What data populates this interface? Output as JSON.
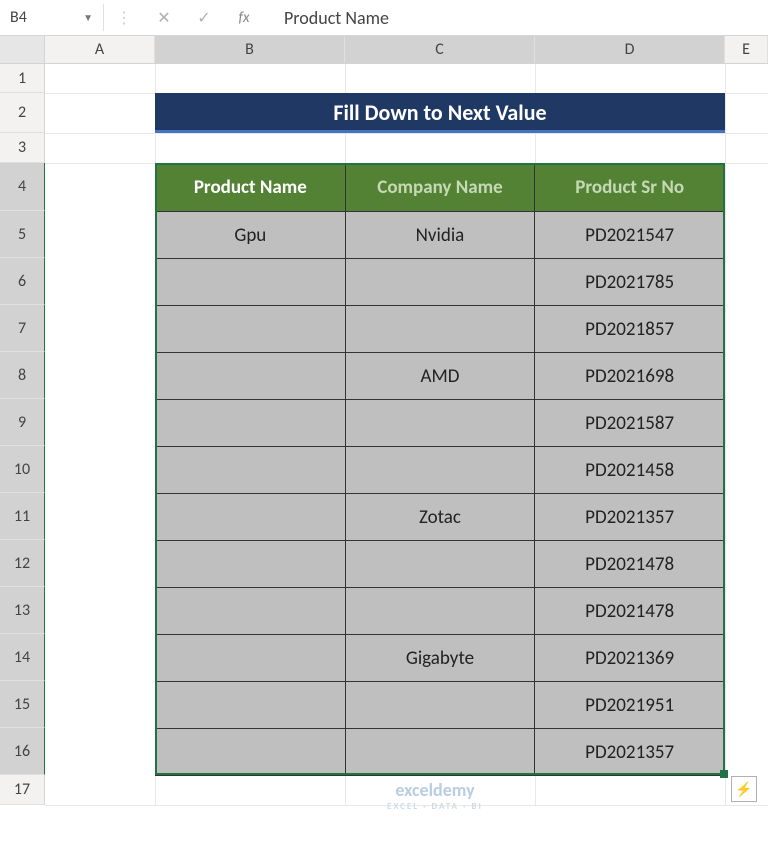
{
  "name_box": {
    "value": "B4"
  },
  "formula_bar": {
    "value": "Product Name"
  },
  "columns": [
    "A",
    "B",
    "C",
    "D",
    "E"
  ],
  "rows": [
    "1",
    "2",
    "3",
    "4",
    "5",
    "6",
    "7",
    "8",
    "9",
    "10",
    "11",
    "12",
    "13",
    "14",
    "15",
    "16",
    "17"
  ],
  "title_banner": "Fill Down to Next Value",
  "table": {
    "headers": [
      "Product Name",
      "Company  Name",
      "Product Sr No"
    ],
    "rows": [
      {
        "product": "Gpu",
        "company": "Nvidia",
        "sr": "PD2021547"
      },
      {
        "product": "",
        "company": "",
        "sr": "PD2021785"
      },
      {
        "product": "",
        "company": "",
        "sr": "PD2021857"
      },
      {
        "product": "",
        "company": "AMD",
        "sr": "PD2021698"
      },
      {
        "product": "",
        "company": "",
        "sr": "PD2021587"
      },
      {
        "product": "",
        "company": "",
        "sr": "PD2021458"
      },
      {
        "product": "",
        "company": "Zotac",
        "sr": "PD2021357"
      },
      {
        "product": "",
        "company": "",
        "sr": "PD2021478"
      },
      {
        "product": "",
        "company": "",
        "sr": "PD2021478"
      },
      {
        "product": "",
        "company": "Gigabyte",
        "sr": "PD2021369"
      },
      {
        "product": "",
        "company": "",
        "sr": "PD2021951"
      },
      {
        "product": "",
        "company": "",
        "sr": "PD2021357"
      }
    ]
  },
  "watermark": {
    "brand": "exceldemy",
    "tag": "EXCEL · DATA · BI"
  },
  "icons": {
    "dropdown": "▼",
    "cancel": "✕",
    "confirm": "✓",
    "fx": "fx",
    "smarttag": "⚡"
  },
  "selection": {
    "address": "B4:D16"
  }
}
